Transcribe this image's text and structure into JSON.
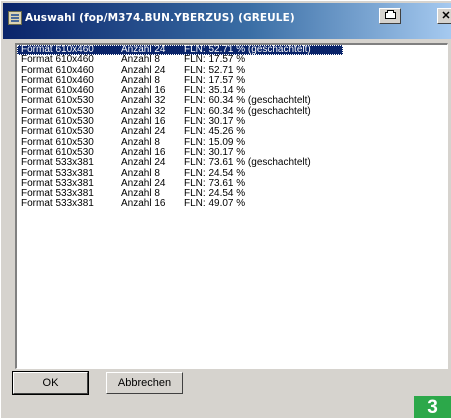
{
  "window": {
    "title": "Auswahl (fop/M374.BUN.YBERZUS) (GREULE)",
    "close_glyph": "✕"
  },
  "list": {
    "rows": [
      {
        "format": "Format 610x460",
        "anzahl": "Anzahl 24",
        "fln": "FLN: 52.71 % (geschachtelt)",
        "selected": true
      },
      {
        "format": "Format 610x460",
        "anzahl": "Anzahl 8",
        "fln": "FLN: 17.57 %"
      },
      {
        "format": "Format 610x460",
        "anzahl": "Anzahl 24",
        "fln": "FLN: 52.71 %"
      },
      {
        "format": "Format 610x460",
        "anzahl": "Anzahl 8",
        "fln": "FLN: 17.57 %"
      },
      {
        "format": "Format 610x460",
        "anzahl": "Anzahl 16",
        "fln": "FLN: 35.14 %"
      },
      {
        "format": "Format 610x530",
        "anzahl": "Anzahl 32",
        "fln": "FLN: 60.34 % (geschachtelt)"
      },
      {
        "format": "Format 610x530",
        "anzahl": "Anzahl 32",
        "fln": "FLN: 60.34 % (geschachtelt)"
      },
      {
        "format": "Format 610x530",
        "anzahl": "Anzahl 16",
        "fln": "FLN: 30.17 %"
      },
      {
        "format": "Format 610x530",
        "anzahl": "Anzahl 24",
        "fln": "FLN: 45.26 %"
      },
      {
        "format": "Format 610x530",
        "anzahl": "Anzahl 8",
        "fln": "FLN: 15.09 %"
      },
      {
        "format": "Format 610x530",
        "anzahl": "Anzahl 16",
        "fln": "FLN: 30.17 %"
      },
      {
        "format": "Format 533x381",
        "anzahl": "Anzahl 24",
        "fln": "FLN: 73.61 % (geschachtelt)"
      },
      {
        "format": "Format 533x381",
        "anzahl": "Anzahl 8",
        "fln": "FLN: 24.54 %"
      },
      {
        "format": "Format 533x381",
        "anzahl": "Anzahl 24",
        "fln": "FLN: 73.61 %"
      },
      {
        "format": "Format 533x381",
        "anzahl": "Anzahl 8",
        "fln": "FLN: 24.54 %"
      },
      {
        "format": "Format 533x381",
        "anzahl": "Anzahl 16",
        "fln": "FLN: 49.07 %"
      }
    ]
  },
  "buttons": {
    "ok_label": "OK",
    "cancel_label": "Abbrechen"
  },
  "figure_badge": "3",
  "colors": {
    "selection": "#0a246a",
    "dialog_face": "#d6d3ce",
    "badge": "#2ca84a"
  }
}
